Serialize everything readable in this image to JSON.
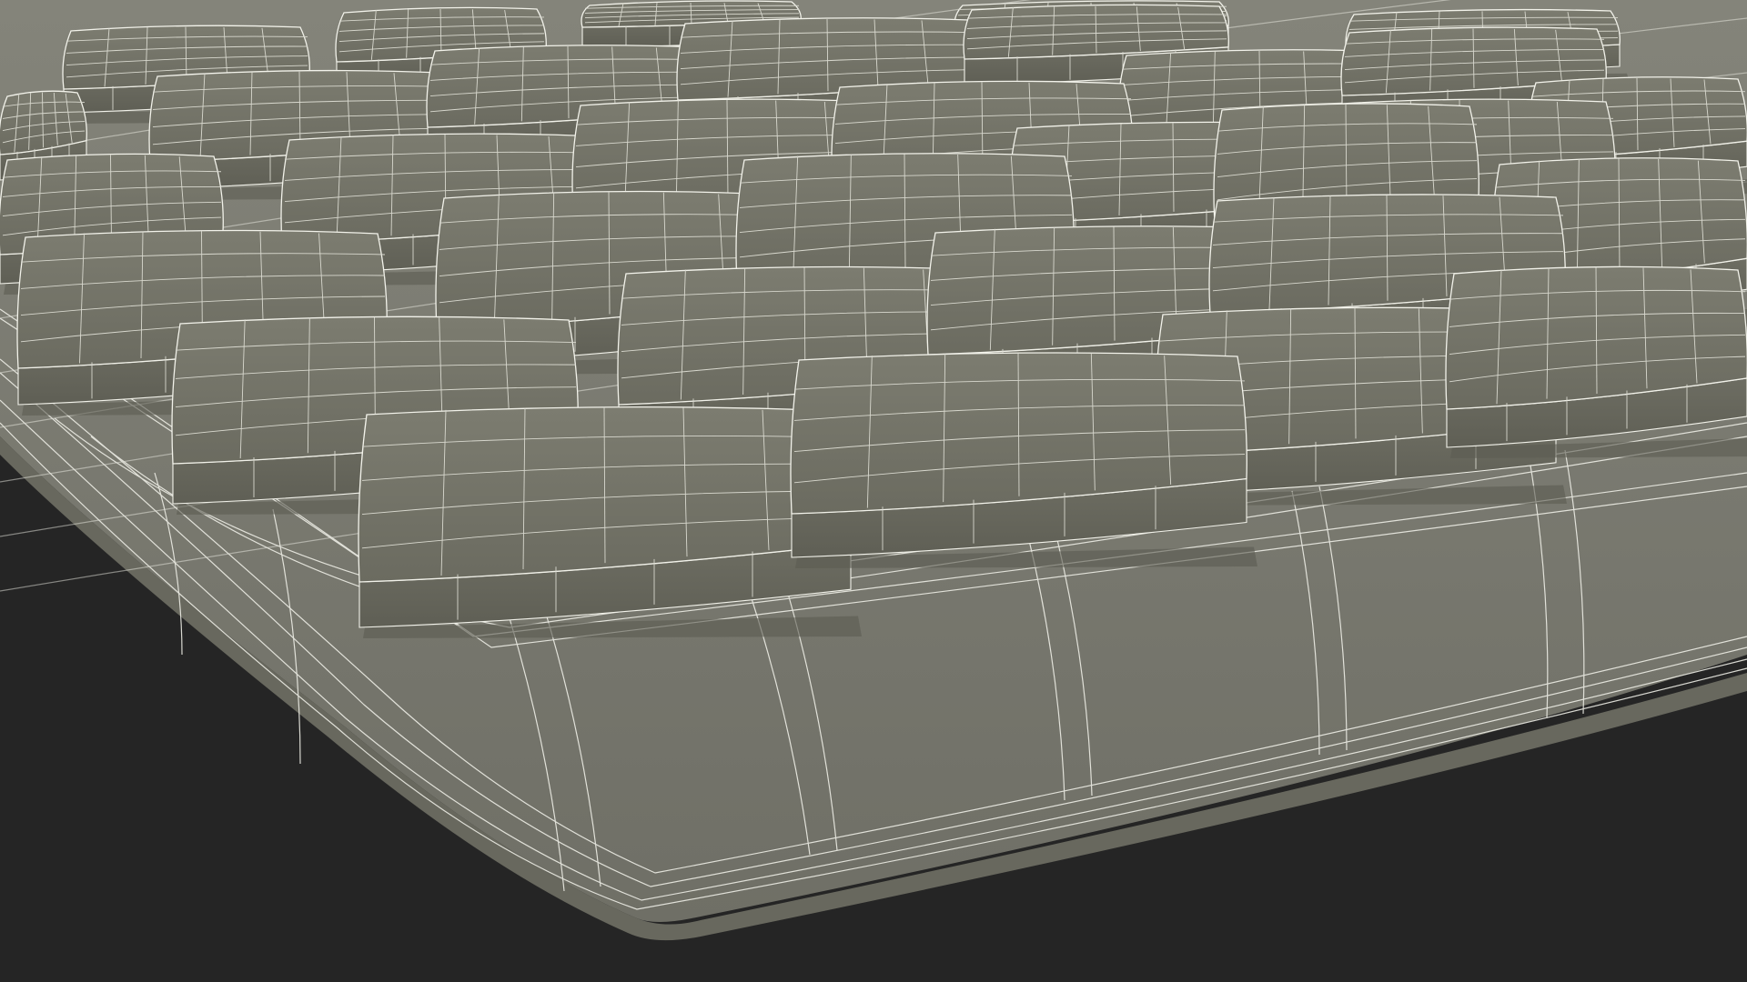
{
  "scene": {
    "subject": "keyboard-wireframe-render",
    "colors": {
      "background": "#252525",
      "body_fill": "#7f7f74",
      "body_shade": "#6f6f66",
      "key_top": "#767669",
      "key_side": "#69695e",
      "key_shadow": "#5c5c52",
      "wire": "#f2f2ea",
      "wire_dim": "#d8d8ce"
    },
    "wireframe": true,
    "key_count_visible": 34
  }
}
